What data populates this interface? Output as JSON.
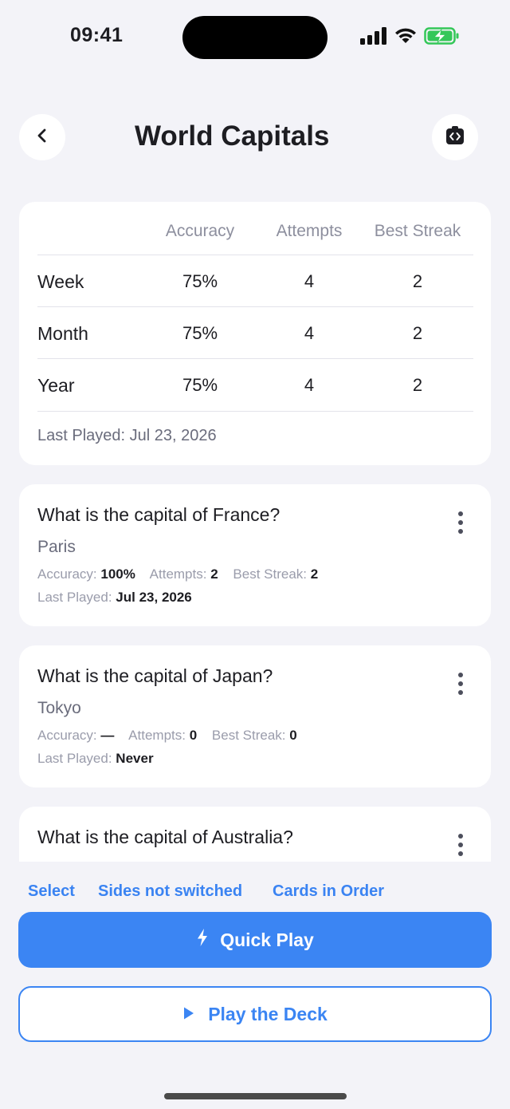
{
  "status": {
    "time": "09:41"
  },
  "header": {
    "title": "World Capitals"
  },
  "stats": {
    "columns": [
      "Accuracy",
      "Attempts",
      "Best Streak"
    ],
    "rows": [
      {
        "label": "Week",
        "accuracy": "75%",
        "attempts": "4",
        "best_streak": "2"
      },
      {
        "label": "Month",
        "accuracy": "75%",
        "attempts": "4",
        "best_streak": "2"
      },
      {
        "label": "Year",
        "accuracy": "75%",
        "attempts": "4",
        "best_streak": "2"
      }
    ],
    "last_played": "Last Played: Jul 23, 2026"
  },
  "cards": [
    {
      "question": "What is the capital of France?",
      "answer": "Paris",
      "accuracy_label": "Accuracy:",
      "accuracy": "100%",
      "attempts_label": "Attempts:",
      "attempts": "2",
      "streak_label": "Best Streak:",
      "streak": "2",
      "last_played_label": "Last Played:",
      "last_played": "Jul 23, 2026"
    },
    {
      "question": "What is the capital of Japan?",
      "answer": "Tokyo",
      "accuracy_label": "Accuracy:",
      "accuracy": "—",
      "attempts_label": "Attempts:",
      "attempts": "0",
      "streak_label": "Best Streak:",
      "streak": "0",
      "last_played_label": "Last Played:",
      "last_played": "Never"
    },
    {
      "question": "What is the capital of Australia?"
    }
  ],
  "options": {
    "select": "Select",
    "sides": "Sides not switched",
    "order": "Cards in Order"
  },
  "actions": {
    "quick_play": "Quick Play",
    "play_deck": "Play the Deck"
  },
  "colors": {
    "accent": "#3b85f3",
    "background": "#f3f3f8",
    "battery": "#34c759"
  },
  "icons": [
    "back-chevron-icon",
    "share-icon",
    "signal-icon",
    "wifi-icon",
    "battery-charging-icon",
    "kebab-menu-icon",
    "bolt-icon",
    "play-icon"
  ]
}
